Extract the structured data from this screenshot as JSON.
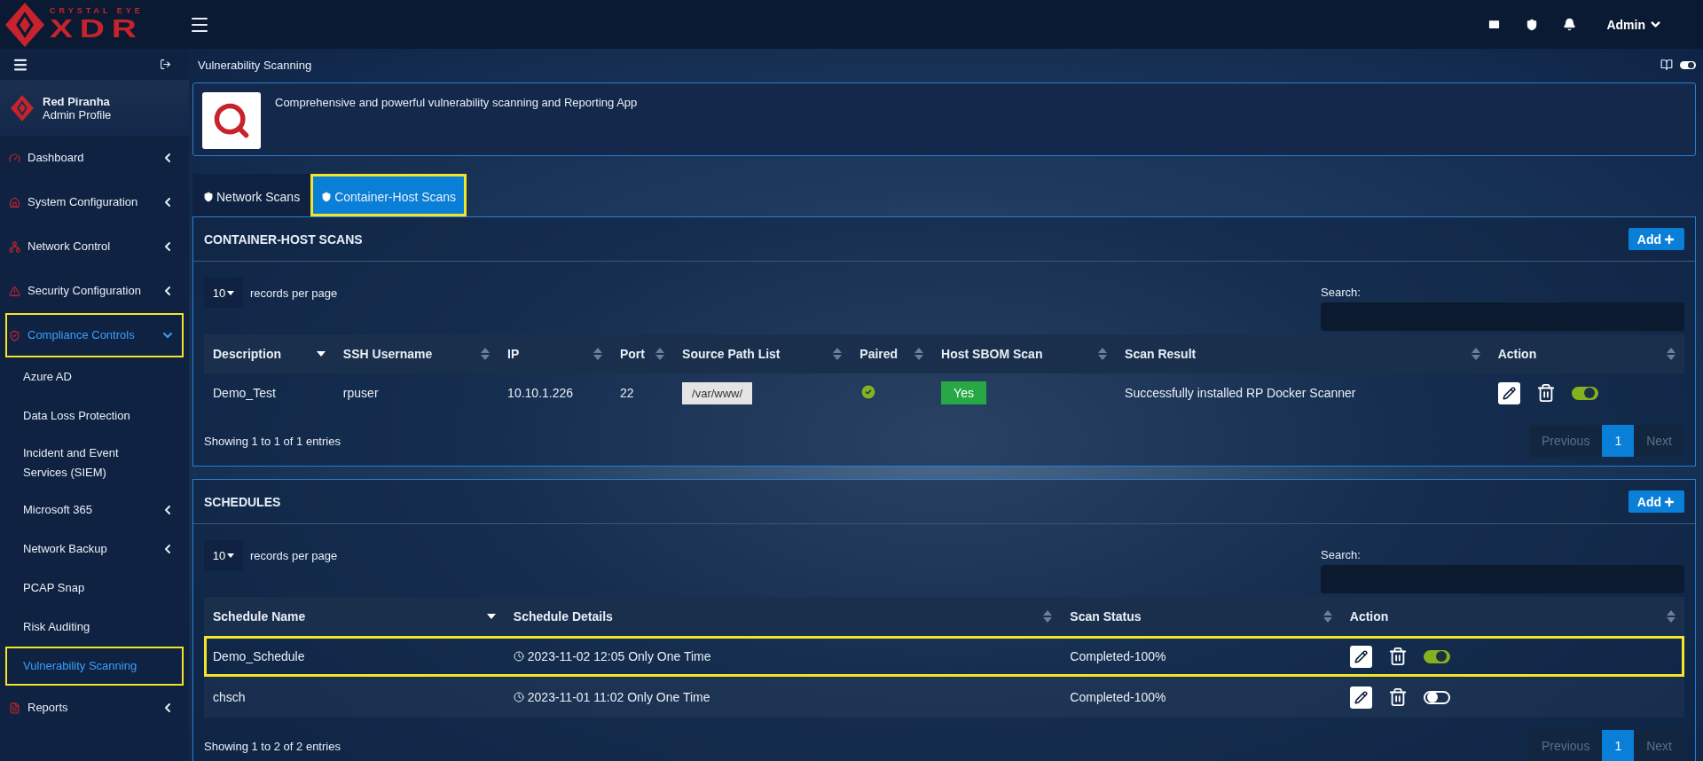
{
  "logo": {
    "tagline": "CRYSTAL EYE",
    "name": "XDR"
  },
  "header": {
    "user": "Admin"
  },
  "sidebar": {
    "profile": {
      "name": "Red Piranha",
      "role": "Admin Profile"
    },
    "items": [
      {
        "label": "Dashboard",
        "kind": "group",
        "expanded": false,
        "highlighted": false
      },
      {
        "label": "System Configuration",
        "kind": "group",
        "expanded": false,
        "highlighted": false
      },
      {
        "label": "Network Control",
        "kind": "group",
        "expanded": false,
        "highlighted": false
      },
      {
        "label": "Security Configuration",
        "kind": "group",
        "expanded": false,
        "highlighted": false
      },
      {
        "label": "Compliance Controls",
        "kind": "group",
        "expanded": true,
        "highlighted": true,
        "children": [
          {
            "label": "Azure AD",
            "kind": "link",
            "selected": false,
            "highlighted": false
          },
          {
            "label": "Data Loss Protection",
            "kind": "link",
            "selected": false,
            "highlighted": false
          },
          {
            "label": "Incident and Event Services (SIEM)",
            "kind": "link",
            "selected": false,
            "highlighted": false
          },
          {
            "label": "Microsoft 365",
            "kind": "group",
            "expanded": false,
            "highlighted": false
          },
          {
            "label": "Network Backup",
            "kind": "group",
            "expanded": false,
            "highlighted": false
          },
          {
            "label": "PCAP Snap",
            "kind": "link",
            "selected": false,
            "highlighted": false
          },
          {
            "label": "Risk Auditing",
            "kind": "link",
            "selected": false,
            "highlighted": false
          },
          {
            "label": "Vulnerability Scanning",
            "kind": "link",
            "selected": true,
            "highlighted": true
          }
        ]
      },
      {
        "label": "Reports",
        "kind": "group",
        "expanded": false,
        "highlighted": false
      }
    ]
  },
  "page": {
    "title": "Vulnerability Scanning"
  },
  "app": {
    "description": "Comprehensive and powerful vulnerability scanning and Reporting App"
  },
  "tabs": [
    {
      "label": "Network Scans",
      "selected": false,
      "highlighted": false
    },
    {
      "label": "Container-Host Scans",
      "selected": true,
      "highlighted": true
    }
  ],
  "scans_panel": {
    "title": "CONTAINER-HOST SCANS",
    "add_label": "Add",
    "page_size": "10",
    "page_size_label": "records per page",
    "search_label": "Search:",
    "columns": [
      {
        "label": "Description",
        "sorted": true
      },
      {
        "label": "SSH Username",
        "sorted": false
      },
      {
        "label": "IP",
        "sorted": false
      },
      {
        "label": "Port",
        "sorted": false
      },
      {
        "label": "Source Path List",
        "sorted": false
      },
      {
        "label": "Paired",
        "sorted": false
      },
      {
        "label": "Host SBOM Scan",
        "sorted": false
      },
      {
        "label": "Scan Result",
        "sorted": false
      },
      {
        "label": "Action",
        "sorted": false
      }
    ],
    "rows": [
      {
        "description": "Demo_Test",
        "ssh_username": "rpuser",
        "ip": "10.10.1.226",
        "port": "22",
        "source_path": "/var/www/",
        "paired": true,
        "host_sbom": "Yes",
        "scan_result": "Successfully installed RP Docker Scanner",
        "enabled": true
      }
    ],
    "summary": "Showing 1 to 1 of 1 entries",
    "pagination": {
      "previous": "Previous",
      "pages": [
        {
          "label": "1",
          "selected": true
        }
      ],
      "next": "Next"
    }
  },
  "schedules_panel": {
    "title": "SCHEDULES",
    "add_label": "Add",
    "page_size": "10",
    "page_size_label": "records per page",
    "search_label": "Search:",
    "columns": [
      {
        "label": "Schedule Name",
        "sorted": true
      },
      {
        "label": "Schedule Details",
        "sorted": false
      },
      {
        "label": "Scan Status",
        "sorted": false
      },
      {
        "label": "Action",
        "sorted": false
      }
    ],
    "rows": [
      {
        "name": "Demo_Schedule",
        "details": "2023-11-02 12:05 Only One Time",
        "status": "Completed-100%",
        "enabled": true,
        "highlighted": true
      },
      {
        "name": "chsch",
        "details": "2023-11-01 11:02 Only One Time",
        "status": "Completed-100%",
        "enabled": false,
        "highlighted": false
      }
    ],
    "summary": "Showing 1 to 2 of 2 entries",
    "pagination": {
      "previous": "Previous",
      "pages": [
        {
          "label": "1",
          "selected": true
        }
      ],
      "next": "Next"
    }
  }
}
